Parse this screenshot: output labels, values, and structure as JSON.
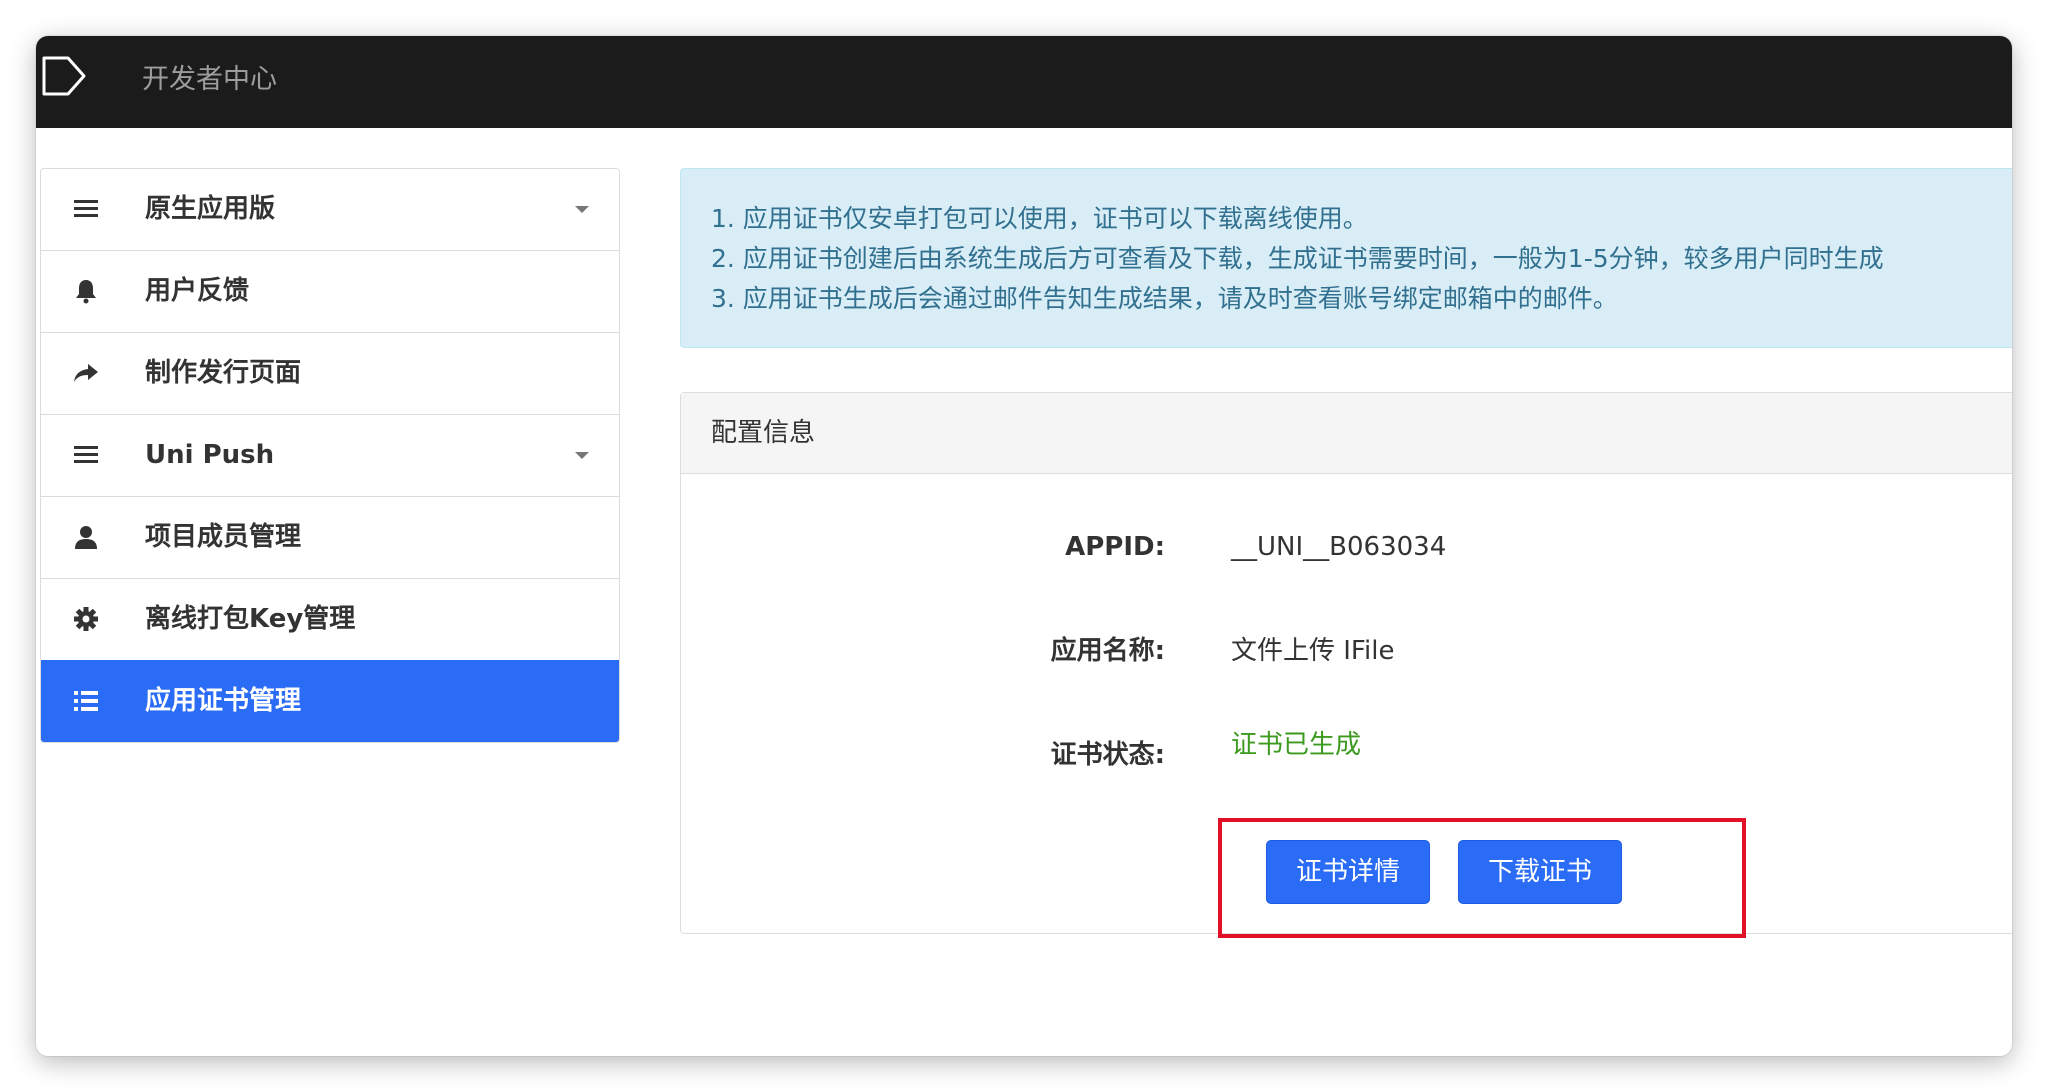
{
  "header": {
    "title": "开发者中心"
  },
  "sidebar": {
    "items": [
      {
        "label": "原生应用版",
        "icon": "list-icon",
        "has_caret": true
      },
      {
        "label": "用户反馈",
        "icon": "bell-icon",
        "has_caret": false
      },
      {
        "label": "制作发行页面",
        "icon": "share-arrow-icon",
        "has_caret": false
      },
      {
        "label": "Uni Push",
        "icon": "list-icon",
        "has_caret": true
      },
      {
        "label": "项目成员管理",
        "icon": "user-icon",
        "has_caret": false
      },
      {
        "label": "离线打包Key管理",
        "icon": "gear-icon",
        "has_caret": false
      },
      {
        "label": "应用证书管理",
        "icon": "list-bullets-icon",
        "has_caret": false,
        "active": true
      }
    ]
  },
  "notice": {
    "lines": [
      "1. 应用证书仅安卓打包可以使用，证书可以下载离线使用。",
      "2. 应用证书创建后由系统生成后方可查看及下载，生成证书需要时间，一般为1-5分钟，较多用户同时生成",
      "3. 应用证书生成后会通过邮件告知生成结果，请及时查看账号绑定邮箱中的邮件。"
    ]
  },
  "config_panel": {
    "title": "配置信息",
    "fields": [
      {
        "label": "APPID:",
        "value": "__UNI__B063034"
      },
      {
        "label": "应用名称:",
        "value": "文件上传 IFile"
      },
      {
        "label": "证书状态:",
        "value": "证书已生成"
      }
    ],
    "buttons": {
      "details_label": "证书详情",
      "download_label": "下载证书"
    }
  },
  "colors": {
    "accent": "#2a6cf6",
    "topbar": "#1b1b1b",
    "status_ok": "#3c9a1f",
    "highlight": "#e3102a",
    "notice_bg": "#d9edf7",
    "notice_text": "#31708f"
  }
}
